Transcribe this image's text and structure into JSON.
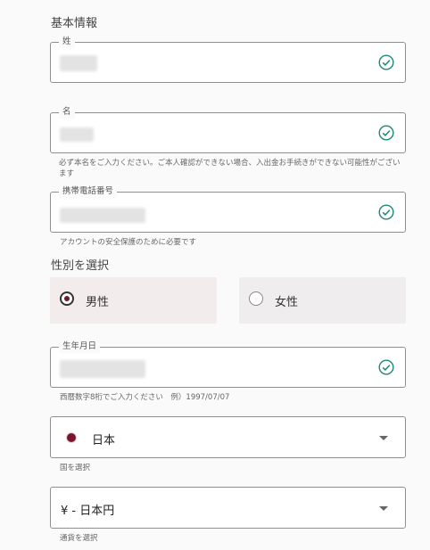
{
  "section": {
    "title": "基本情報"
  },
  "last_name": {
    "label": "姓"
  },
  "first_name": {
    "label": "名",
    "helper": "必ず本名をご入力ください。ご本人確認ができない場合、入出金お手続きができない可能性がございます"
  },
  "phone": {
    "label": "携帯電話番号",
    "helper": "アカウントの安全保護のために必要です"
  },
  "gender": {
    "title": "性別を選択",
    "options": [
      "男性",
      "女性"
    ],
    "selected": "男性"
  },
  "birthdate": {
    "label": "生年月日",
    "helper": "西暦数字8桁でご入力ください　例）1997/07/07"
  },
  "country": {
    "value": "日本",
    "helper": "国を選択"
  },
  "currency": {
    "value": "¥ - 日本円",
    "helper": "通貨を選択"
  },
  "colors": {
    "accent": "#6b1b2e",
    "check": "#1e8a76",
    "selected_bg": "#f3ecec",
    "unselected_bg": "#efeded"
  },
  "icons": {
    "valid": "check-circle-icon",
    "dropdown": "chevron-down-icon",
    "flag": "japan-flag-icon"
  }
}
